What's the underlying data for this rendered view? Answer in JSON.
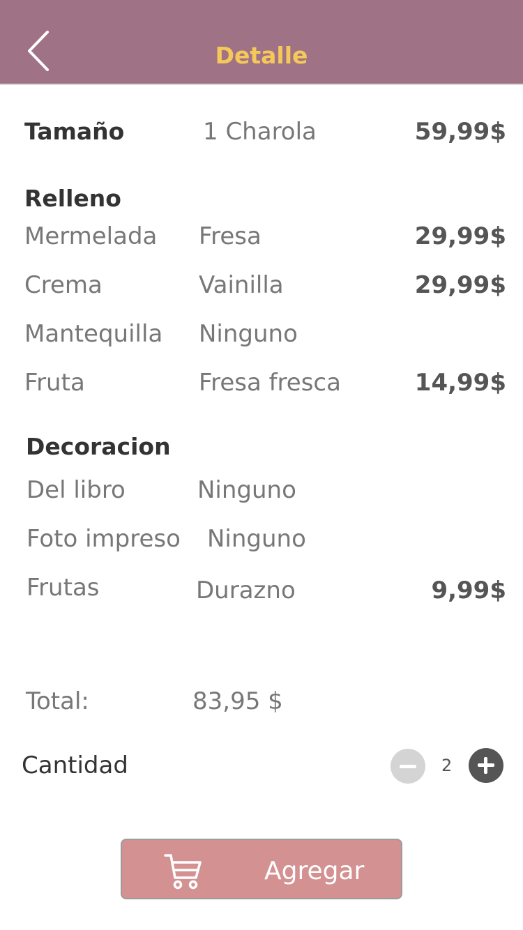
{
  "header": {
    "title": "Detalle"
  },
  "size": {
    "label": "Tamaño",
    "value": "1 Charola",
    "price": "59,99$"
  },
  "filling": {
    "heading": "Relleno",
    "items": [
      {
        "label": "Mermelada",
        "value": "Fresa",
        "price": "29,99$"
      },
      {
        "label": "Crema",
        "value": "Vainilla",
        "price": "29,99$"
      },
      {
        "label": "Mantequilla",
        "value": "Ninguno",
        "price": ""
      },
      {
        "label": "Fruta",
        "value": "Fresa fresca",
        "price": "14,99$"
      }
    ]
  },
  "decoration": {
    "heading": "Decoracion",
    "items": [
      {
        "label": "Del libro",
        "value": "Ninguno",
        "price": ""
      },
      {
        "label": "Foto impreso",
        "value": "Ninguno",
        "price": ""
      },
      {
        "label": "Frutas",
        "value": "Durazno",
        "price": "9,99$"
      }
    ]
  },
  "total": {
    "label": "Total:",
    "value": "83,95 $"
  },
  "quantity": {
    "label": "Cantidad",
    "value": "2"
  },
  "add_button": {
    "label": "Agregar"
  },
  "colors": {
    "header_bg": "#A07285",
    "header_title": "#F5C85A",
    "add_button_bg": "#D39192"
  },
  "icons": {
    "back": "chevron-left-icon",
    "cart": "cart-icon",
    "minus": "minus-circle-icon",
    "plus": "plus-circle-icon"
  }
}
